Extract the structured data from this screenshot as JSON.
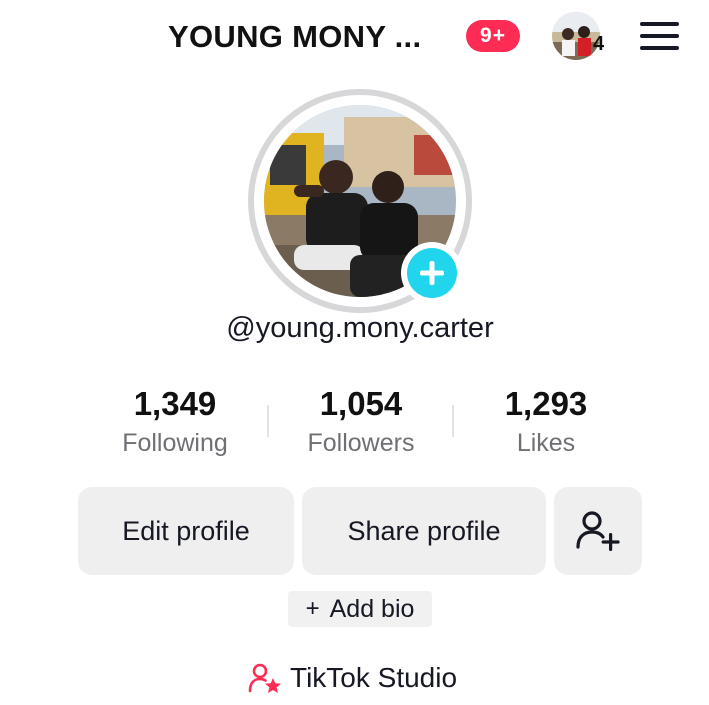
{
  "header": {
    "title": "YOUNG MONY ...",
    "notification_badge": "9+",
    "story_count": "4"
  },
  "profile": {
    "username": "@young.mony.carter"
  },
  "stats": [
    {
      "value": "1,349",
      "label": "Following"
    },
    {
      "value": "1,054",
      "label": "Followers"
    },
    {
      "value": "1,293",
      "label": "Likes"
    }
  ],
  "actions": {
    "edit_profile": "Edit profile",
    "share_profile": "Share profile",
    "add_bio": "Add bio",
    "tiktok_studio": "TikTok Studio"
  },
  "icons": {
    "menu": "hamburger-menu-icon",
    "add_avatar": "plus-circle-icon",
    "add_friend": "person-plus-icon",
    "studio": "person-star-icon"
  },
  "colors": {
    "badge": "#fe2c55",
    "add_avatar": "#20d5ec",
    "studio_icon": "#fe2c55"
  }
}
